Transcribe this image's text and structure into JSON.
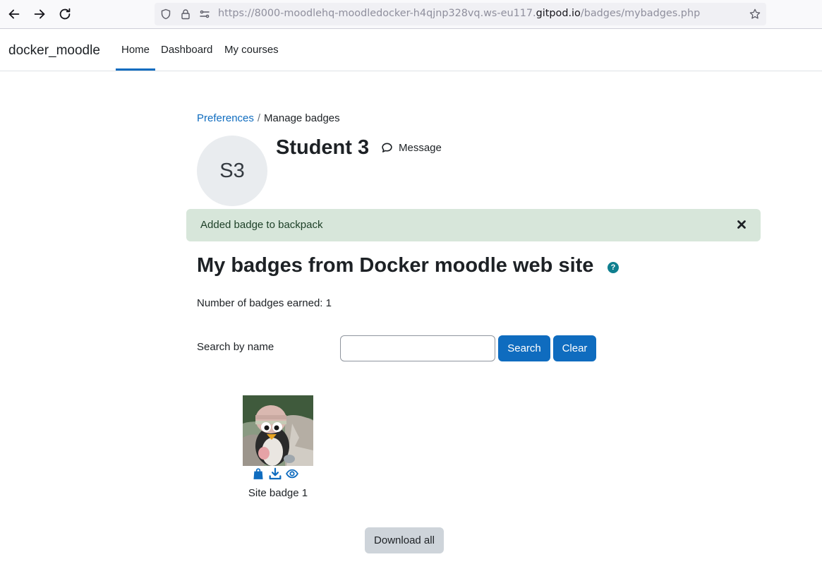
{
  "browser": {
    "url_prefix": "https://8000-moodlehq-moodledocker-h4qjnp328vq.ws-eu117.",
    "url_host": "gitpod.io",
    "url_path": "/badges/mybadges.php"
  },
  "navbar": {
    "brand": "docker_moodle",
    "items": [
      {
        "label": "Home",
        "active": true
      },
      {
        "label": "Dashboard",
        "active": false
      },
      {
        "label": "My courses",
        "active": false
      }
    ]
  },
  "breadcrumb": {
    "parent": "Preferences",
    "separator": "/",
    "current": "Manage badges"
  },
  "user": {
    "initials": "S3",
    "name": "Student 3",
    "message_label": "Message"
  },
  "alert": {
    "text": "Added badge to backpack"
  },
  "main": {
    "heading": "My badges from Docker moodle web site",
    "help_glyph": "?",
    "badge_count_text": "Number of badges earned: 1"
  },
  "search": {
    "label": "Search by name",
    "value": "",
    "search_button": "Search",
    "clear_button": "Clear"
  },
  "badges": [
    {
      "name": "Site badge 1",
      "actions": [
        "backpack-icon",
        "download-icon",
        "visibility-eye-icon"
      ]
    }
  ],
  "download_all_label": "Download all",
  "colors": {
    "accent": "#0f6cbf",
    "alert_bg": "#d7e6da",
    "help_icon": "#0f7f8f"
  }
}
